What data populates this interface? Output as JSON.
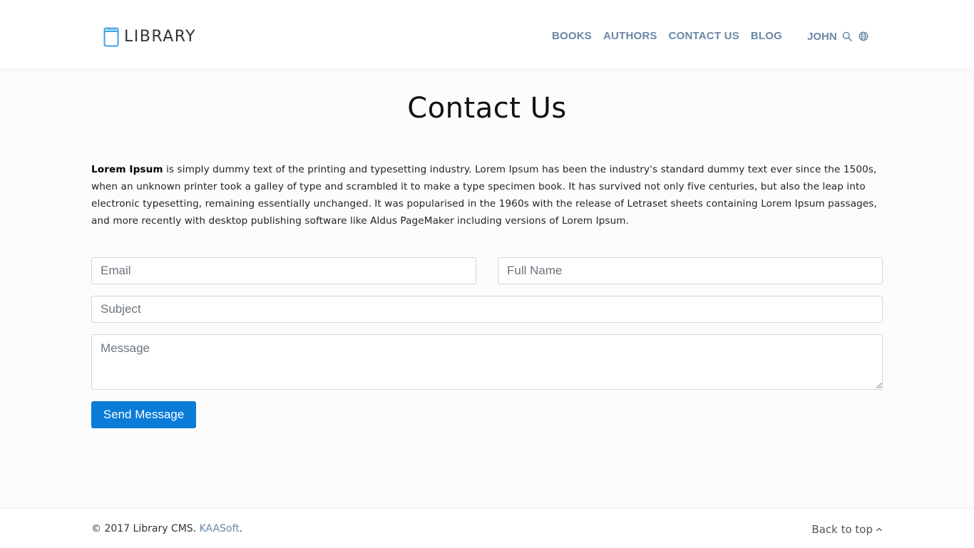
{
  "header": {
    "logo_text": "LIBRARY",
    "nav": [
      {
        "label": "BOOKS"
      },
      {
        "label": "AUTHORS"
      },
      {
        "label": "CONTACT US"
      },
      {
        "label": "BLOG"
      }
    ],
    "user": "JOHN",
    "icons": [
      "book-icon",
      "search-icon",
      "globe-icon"
    ]
  },
  "main": {
    "title": "Contact Us",
    "intro_bold": "Lorem Ipsum",
    "intro_rest": " is simply dummy text of the printing and typesetting industry. Lorem Ipsum has been the industry's standard dummy text ever since the 1500s, when an unknown printer took a galley of type and scrambled it to make a type specimen book. It has survived not only five centuries, but also the leap into electronic typesetting, remaining essentially unchanged. It was popularised in the 1960s with the release of Letraset sheets containing Lorem Ipsum passages, and more recently with desktop publishing software like Aldus PageMaker including versions of Lorem Ipsum."
  },
  "form": {
    "email_placeholder": "Email",
    "name_placeholder": "Full Name",
    "subject_placeholder": "Subject",
    "message_placeholder": "Message",
    "send_label": "Send Message"
  },
  "footer": {
    "copyright_prefix": "© 2017 Library CMS. ",
    "company": "KAASoft",
    "copyright_suffix": ".",
    "back_to_top": "Back to top"
  },
  "colors": {
    "accent": "#0b7bd8",
    "nav": "#6b87a5",
    "logo_icon": "#3aa3e3"
  }
}
